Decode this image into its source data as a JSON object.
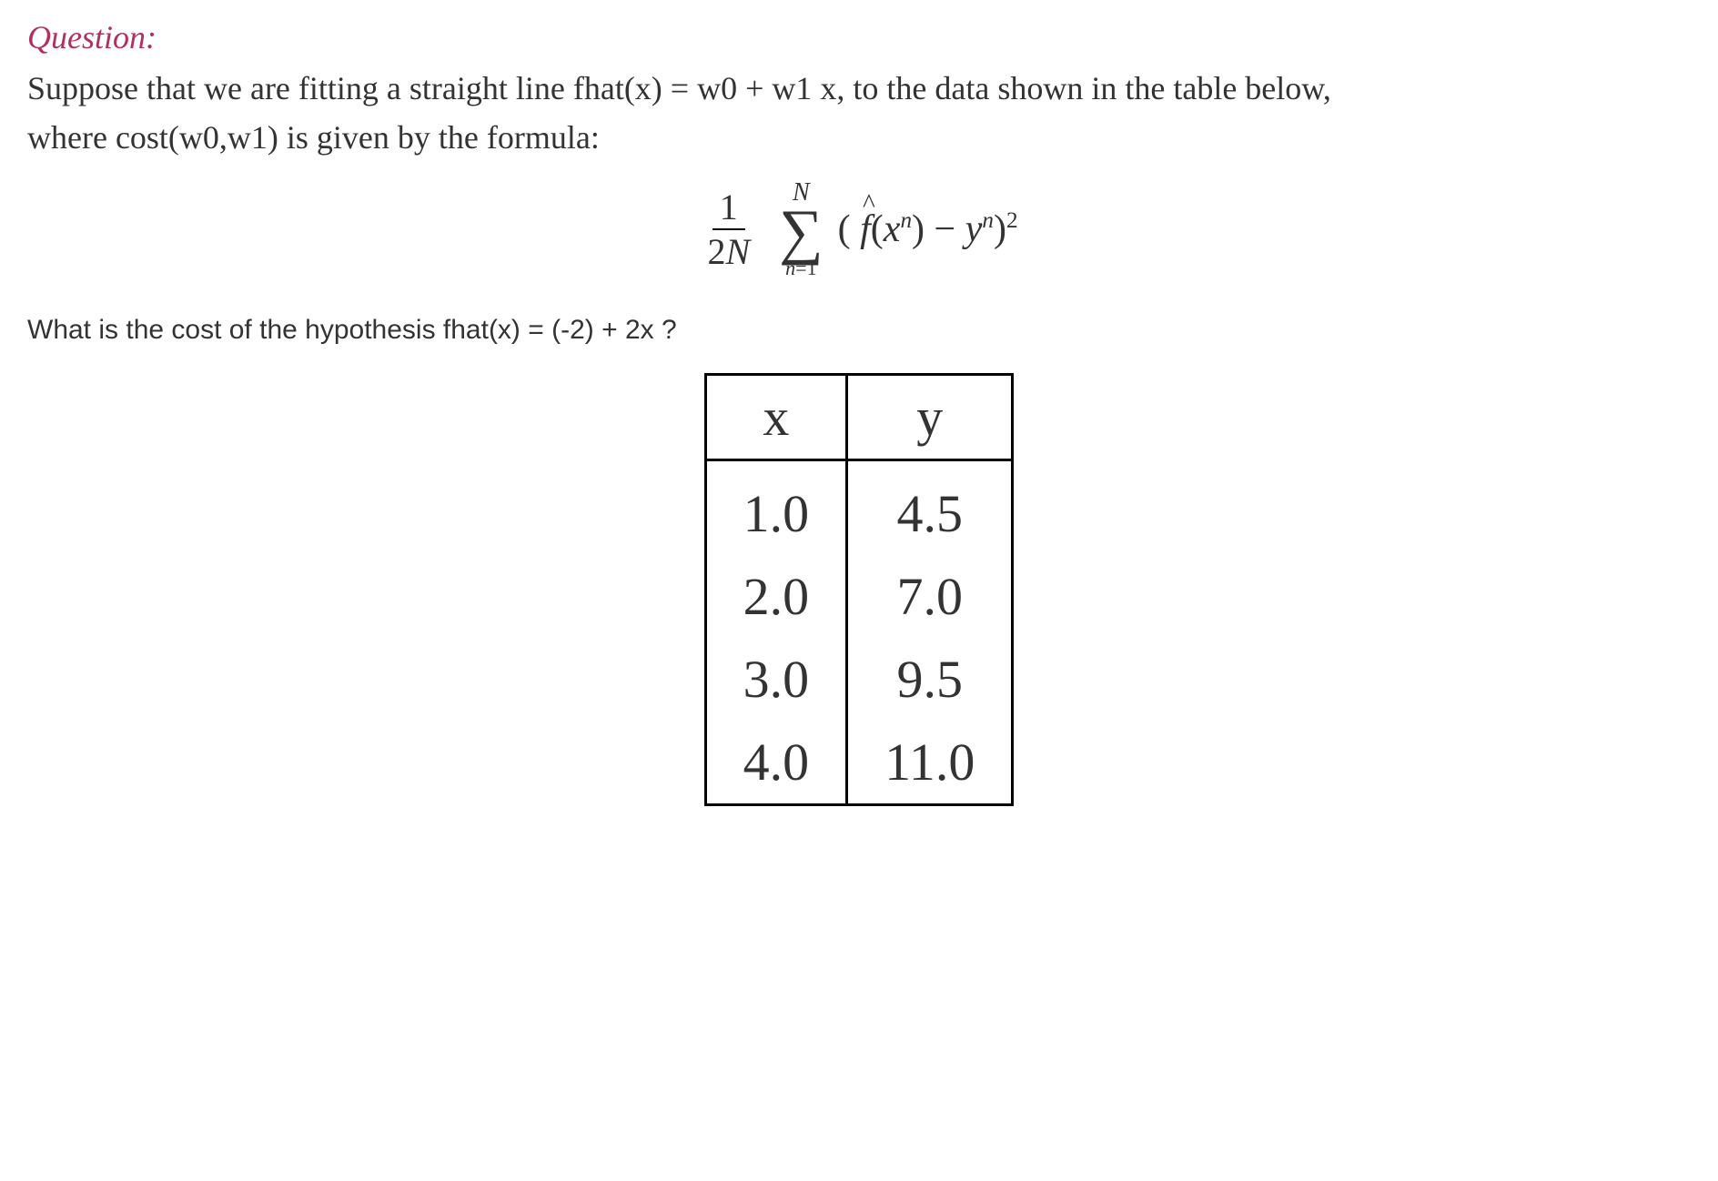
{
  "question": {
    "label": "Question:",
    "text_line1": "Suppose that we are fitting a straight line fhat(x) = w0 + w1 x, to the data shown in the table below,",
    "text_line2": "where cost(w0,w1) is given by the formula:",
    "sub_question": "What is the cost of the hypothesis fhat(x) = (-2) + 2x ?"
  },
  "formula": {
    "fraction_numerator": "1",
    "fraction_denominator": "2N",
    "sigma_upper": "N",
    "sigma_lower": "n=1",
    "body": "( f̂(xⁿ) − yⁿ )²"
  },
  "chart_data": {
    "type": "table",
    "columns": [
      "x",
      "y"
    ],
    "rows": [
      {
        "x": "1.0",
        "y": "4.5"
      },
      {
        "x": "2.0",
        "y": "7.0"
      },
      {
        "x": "3.0",
        "y": "9.5"
      },
      {
        "x": "4.0",
        "y": "11.0"
      }
    ]
  }
}
